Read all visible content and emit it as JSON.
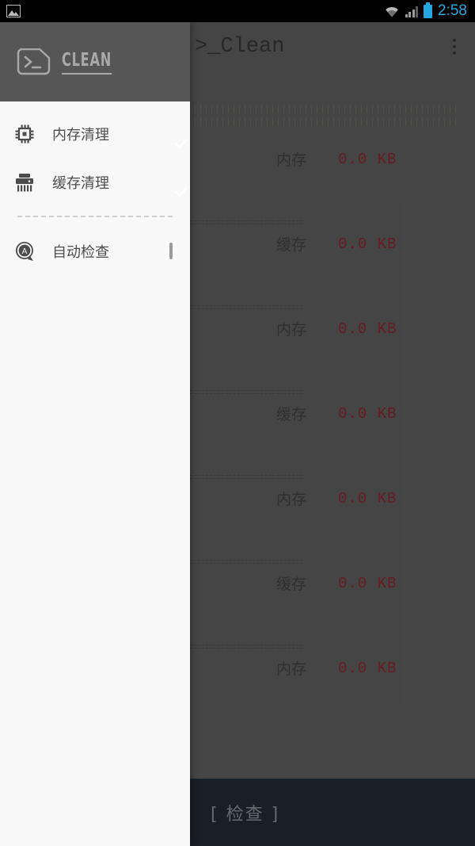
{
  "statusbar": {
    "notification_icon": "gallery-icon",
    "wifi_icon": "wifi-icon",
    "signal_icon": "cellular-signal-icon",
    "battery_icon": "battery-icon",
    "clock": "2:58"
  },
  "appbar": {
    "title": ">_Clean",
    "overflow_icon": "more-vertical-icon"
  },
  "drawer": {
    "logo_icon": "terminal-prompt-icon",
    "logo_text": "CLEAN",
    "items": [
      {
        "label": "内存清理",
        "icon": "cpu-chip-icon",
        "checked": true
      },
      {
        "label": "缓存清理",
        "icon": "shredder-icon",
        "checked": true
      },
      {
        "label": "自动检查",
        "icon": "auto-badge-icon",
        "checked": false
      }
    ]
  },
  "list": {
    "rows": [
      {
        "label": "内存",
        "value": "0.0 KB"
      },
      {
        "label": "缓存",
        "value": "0.0 KB"
      },
      {
        "label": "内存",
        "value": "0.0 KB"
      },
      {
        "label": "缓存",
        "value": "0.0 KB"
      },
      {
        "label": "内存",
        "value": "0.0 KB"
      },
      {
        "label": "缓存",
        "value": "0.0 KB"
      },
      {
        "label": "内存",
        "value": "0.0 KB"
      }
    ]
  },
  "bottombar": {
    "action_label": "[ 检查 ]"
  },
  "colors": {
    "accent_value": "#9b2b34",
    "clock": "#25a9e0",
    "battery": "#22a7e0",
    "drawer_bg": "#f8f8f8",
    "drawer_header_bg": "#565656",
    "bottombar_bg": "#262f3a",
    "content_bg": "#6a6a6a"
  }
}
